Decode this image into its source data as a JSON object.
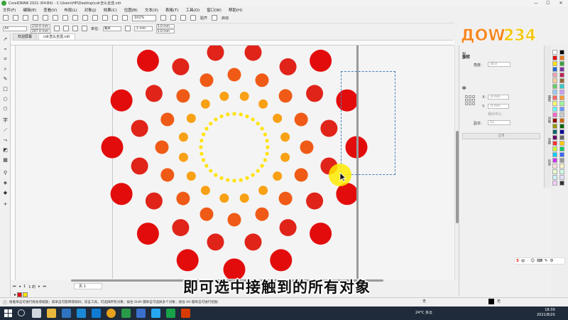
{
  "window": {
    "title": "CorelDRAW 2021 (64-Bit) - C:\\Users\\HP\\Desktop\\cdr怎么全选.cdr",
    "minimize_label": "—",
    "maximize_label": "☐",
    "close_label": "✕"
  },
  "menubar": {
    "items": [
      "文件(F)",
      "编辑(E)",
      "查看(V)",
      "布局(L)",
      "对象(J)",
      "效果(C)",
      "位图(B)",
      "文本(X)",
      "表格(T)",
      "工具(O)",
      "窗口(W)",
      "帮助(H)"
    ]
  },
  "toolbar": {
    "zoom_value": "101%",
    "snap_label": "贴齐",
    "launch_label": "启动"
  },
  "propbar": {
    "page_size": "A4",
    "width": "210.0 mm",
    "height": "297.0 mm",
    "units_label": "单位:",
    "units_value": "毫米",
    "nudge": ".1 mm",
    "dup_x": "5.0 mm",
    "dup_y": "5.0 mm"
  },
  "tabs": [
    {
      "label": "欢迎屏幕"
    },
    {
      "label": "cdr怎么全选.cdr"
    }
  ],
  "canvas": {
    "selection_visible": true
  },
  "subtitle": "即可选中接触到的所有对象",
  "pagenav": {
    "page_count": "1 的",
    "page_number": "1",
    "page_tab": "页 1"
  },
  "statusbar": {
    "hint": "接着单击可进行拖动或缩放；再单击可旋转或倾斜；双击工具，可选择所有对象；按住 Shift 键单击可选择多个对象；按住 Alt 键单击可进行挖掘",
    "fill_label": "无",
    "outline_label": "无"
  },
  "docker": {
    "header_label": "形",
    "rotate_title": "旋转",
    "angle_label": "角度:",
    "angle_value": "30.0",
    "center_title": "中",
    "x_label": "X:",
    "x_value": ".0 mm",
    "y_label": "Y:",
    "y_value": ".0 mm",
    "relative_label": "相对中心",
    "copies_label": "副本:",
    "copies_value": "12",
    "apply_label": "应用",
    "side_tabs": [
      "属性",
      "对象",
      "变换",
      "形状"
    ]
  },
  "logo": {
    "text": "ДОW234"
  },
  "ime": {
    "items": [
      "中",
      "·",
      "☺",
      "⌨",
      "✎",
      "⚙"
    ]
  },
  "taskbar": {
    "weather": "24°C 多云",
    "time": "18:39",
    "date": "2021/8/20"
  },
  "colors": {
    "outer_ring": "#e30c0c",
    "ring2": "#e0241a",
    "ring3": "#ef5b17",
    "ring4": "#f8a115",
    "inner_ring": "#ffe30a",
    "selection_dash": "#4a7fbf",
    "highlight": "#ffeb00"
  },
  "icons": [
    "pick-tool-icon",
    "shape-tool-icon",
    "crop-tool-icon",
    "zoom-tool-icon",
    "freehand-tool-icon",
    "rectangle-tool-icon",
    "ellipse-tool-icon",
    "polygon-tool-icon",
    "text-tool-icon",
    "parallel-dimension-icon",
    "connector-icon",
    "drop-shadow-icon",
    "transparency-icon",
    "eyedropper-icon",
    "fill-icon",
    "interactive-fill-icon"
  ]
}
